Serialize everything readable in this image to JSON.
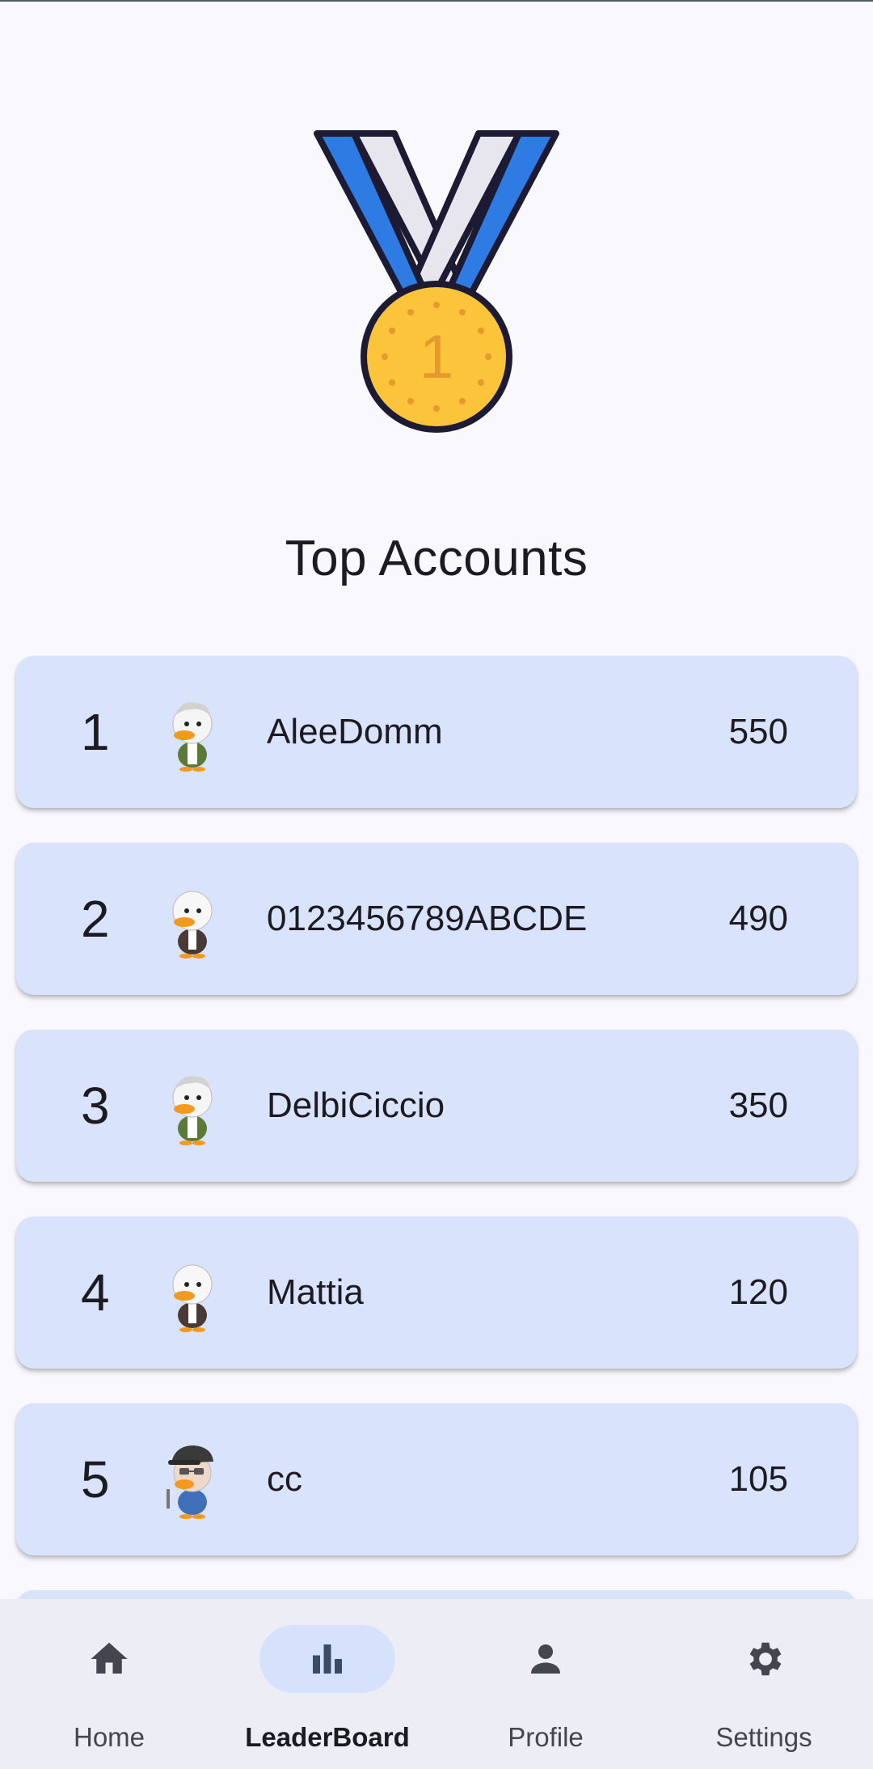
{
  "header": {
    "title": "Top Accounts"
  },
  "medal": {
    "number": "1",
    "icon": "medal-icon"
  },
  "leaderboard": [
    {
      "rank": "1",
      "name": "AleeDomm",
      "score": "550",
      "avatar": "duck-avatar-gray-hair"
    },
    {
      "rank": "2",
      "name": "0123456789ABCDE",
      "score": "490",
      "avatar": "duck-avatar-suit"
    },
    {
      "rank": "3",
      "name": "DelbiCiccio",
      "score": "350",
      "avatar": "duck-avatar-gray-hair"
    },
    {
      "rank": "4",
      "name": "Mattia",
      "score": "120",
      "avatar": "duck-avatar-suit"
    },
    {
      "rank": "5",
      "name": "cc",
      "score": "105",
      "avatar": "duck-avatar-cap-glasses"
    }
  ],
  "nav": {
    "items": [
      {
        "label": "Home",
        "icon": "home-icon",
        "active": false
      },
      {
        "label": "LeaderBoard",
        "icon": "leaderboard-icon",
        "active": true
      },
      {
        "label": "Profile",
        "icon": "profile-icon",
        "active": false
      },
      {
        "label": "Settings",
        "icon": "settings-icon",
        "active": false
      }
    ]
  },
  "colors": {
    "background": "#f8f8fd",
    "card": "#d9e3fc",
    "navbar": "#ededf5",
    "nav_active_pill": "#d6e2fb",
    "medal_gold": "#fcc43b",
    "ribbon_blue": "#2e7be3",
    "ribbon_white": "#e7e5ee"
  }
}
